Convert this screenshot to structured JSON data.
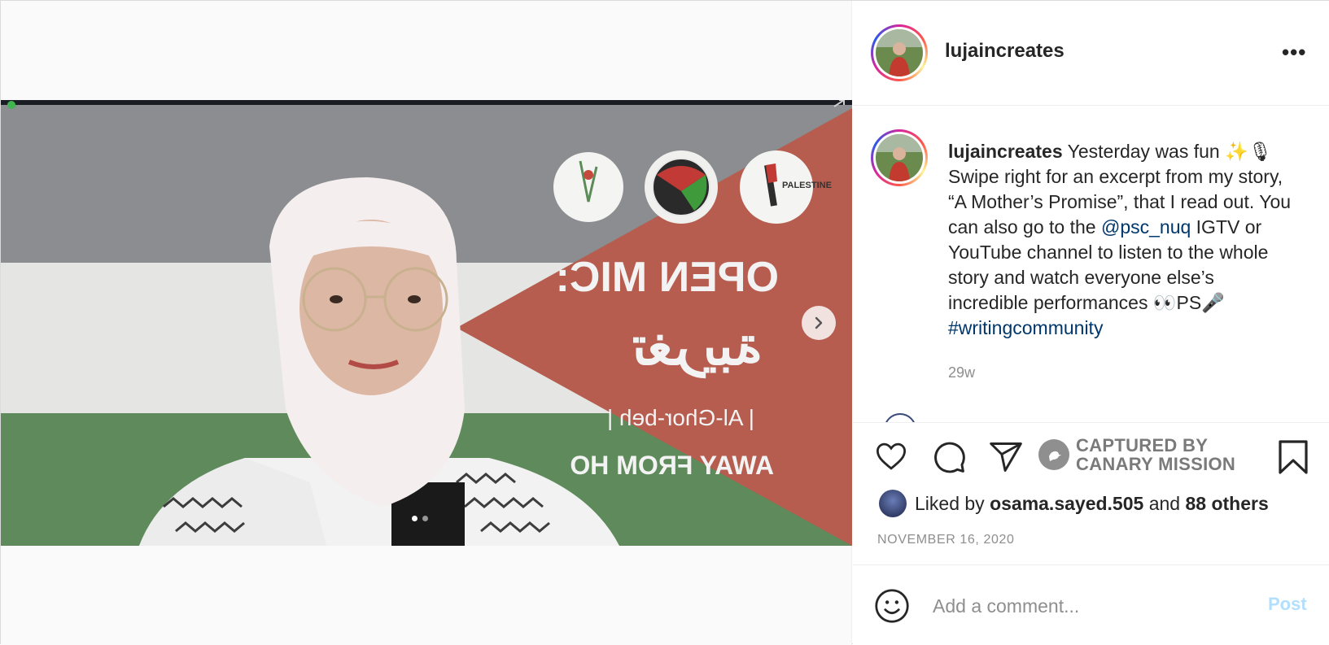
{
  "post": {
    "username": "lujaincreates",
    "more_label": "•••",
    "caption": {
      "username": "lujaincreates",
      "text_1": " Yesterday was fun ✨🎙 Swipe right for an excerpt from my story, “A Mother’s Promise”, that I read out. You can also go to the ",
      "mention": "@psc_nuq",
      "text_2": " IGTV or YouTube channel to listen to the whole story and watch everyone else’s incredible performances 👀PS🎤 ",
      "hashtag": "#writingcommunity"
    },
    "time_ago": "29w",
    "likes": {
      "prefix": "Liked by ",
      "liker": "osama.sayed.505",
      "middle": " and ",
      "others": "88 others"
    },
    "date": "NOVEMBER 16, 2020",
    "comment_placeholder": "Add a comment...",
    "post_label": "Post"
  },
  "watermark": {
    "line1": "CAPTURED BY",
    "line2": "CANARY MISSION"
  },
  "image_text": {
    "open_mic": "OPEN MIC:",
    "arabic": "تغريبة",
    "transliteration": "| Al-Ghor-beh |",
    "away": "AWAY FROM HO"
  },
  "carousel": {
    "slides": 2,
    "active": 1
  },
  "colors": {
    "link": "#00376b",
    "post_button": "#b2dffc",
    "muted": "#8e8e8e",
    "flag_red": "#b45a4c",
    "flag_green": "#5e8a5a",
    "flag_gray": "#828487"
  },
  "icons": [
    "heart-icon",
    "comment-icon",
    "share-icon",
    "bookmark-icon",
    "emoji-icon",
    "chevron-right-icon",
    "more-icon",
    "canary-mission-logo"
  ]
}
